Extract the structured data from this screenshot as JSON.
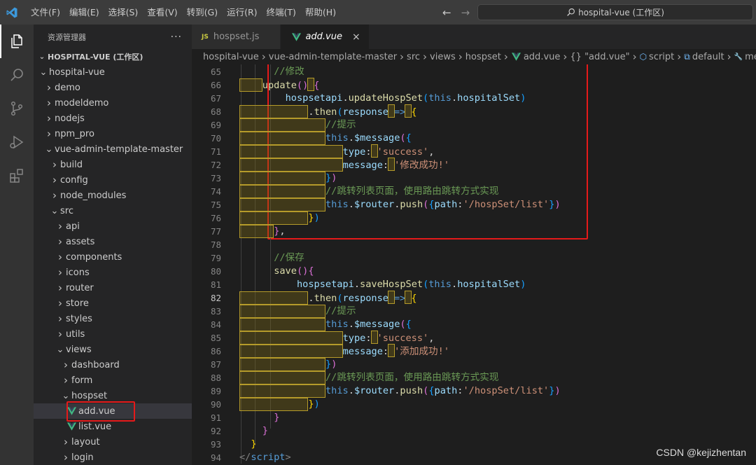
{
  "titlebar": {
    "menu": [
      "文件(F)",
      "编辑(E)",
      "选择(S)",
      "查看(V)",
      "转到(G)",
      "运行(R)",
      "终端(T)",
      "帮助(H)"
    ],
    "command_center": "hospital-vue (工作区)"
  },
  "sidebar": {
    "title": "资源管理器",
    "more": "···",
    "workspace": "HOSPITAL-VUE (工作区)",
    "tree": [
      {
        "label": "hospital-vue",
        "indent": 1,
        "chev": "down"
      },
      {
        "label": "demo",
        "indent": 2,
        "chev": "right"
      },
      {
        "label": "modeldemo",
        "indent": 2,
        "chev": "right"
      },
      {
        "label": "nodejs",
        "indent": 2,
        "chev": "right"
      },
      {
        "label": "npm_pro",
        "indent": 2,
        "chev": "right"
      },
      {
        "label": "vue-admin-template-master",
        "indent": 2,
        "chev": "down"
      },
      {
        "label": "build",
        "indent": 3,
        "chev": "right"
      },
      {
        "label": "config",
        "indent": 3,
        "chev": "right"
      },
      {
        "label": "node_modules",
        "indent": 3,
        "chev": "right"
      },
      {
        "label": "src",
        "indent": 3,
        "chev": "down"
      },
      {
        "label": "api",
        "indent": 4,
        "chev": "right"
      },
      {
        "label": "assets",
        "indent": 4,
        "chev": "right"
      },
      {
        "label": "components",
        "indent": 4,
        "chev": "right"
      },
      {
        "label": "icons",
        "indent": 4,
        "chev": "right"
      },
      {
        "label": "router",
        "indent": 4,
        "chev": "right"
      },
      {
        "label": "store",
        "indent": 4,
        "chev": "right"
      },
      {
        "label": "styles",
        "indent": 4,
        "chev": "right"
      },
      {
        "label": "utils",
        "indent": 4,
        "chev": "right"
      },
      {
        "label": "views",
        "indent": 4,
        "chev": "down"
      },
      {
        "label": "dashboard",
        "indent": 5,
        "chev": "right"
      },
      {
        "label": "form",
        "indent": 5,
        "chev": "right"
      },
      {
        "label": "hospset",
        "indent": 5,
        "chev": "down"
      },
      {
        "label": "add.vue",
        "indent": 6,
        "chev": "vue",
        "selected": true
      },
      {
        "label": "list.vue",
        "indent": 6,
        "chev": "vue"
      },
      {
        "label": "layout",
        "indent": 5,
        "chev": "right"
      },
      {
        "label": "login",
        "indent": 5,
        "chev": "right"
      }
    ]
  },
  "tabs": [
    {
      "label": "hospset.js",
      "badge": "JS",
      "active": false
    },
    {
      "label": "add.vue",
      "badge": "vue",
      "active": true,
      "close": "×"
    }
  ],
  "breadcrumb": [
    "hospital-vue",
    "vue-admin-template-master",
    "src",
    "views",
    "hospset",
    "add.vue",
    "{} \"add.vue\"",
    "script",
    "default",
    "methods"
  ],
  "editor": {
    "current_line": 82,
    "lines": [
      {
        "n": 65,
        "seg": [
          [
            6,
            "pad"
          ],
          [
            "//修改",
            "c"
          ]
        ]
      },
      {
        "n": 66,
        "seg": [
          [
            4,
            "padhl"
          ],
          [
            "update",
            "f"
          ],
          [
            "()",
            "b2"
          ],
          [
            "ws"
          ],
          [
            "{",
            "b2"
          ]
        ]
      },
      {
        "n": 67,
        "seg": [
          [
            8,
            "pad"
          ],
          [
            "hospsetapi",
            "v"
          ],
          [
            ".",
            "p"
          ],
          [
            "updateHospSet",
            "f"
          ],
          [
            "(",
            "b3"
          ],
          [
            "this",
            "k"
          ],
          [
            ".",
            "p"
          ],
          [
            "hospitalSet",
            "v"
          ],
          [
            ")",
            "b3"
          ]
        ]
      },
      {
        "n": 68,
        "seg": [
          [
            12,
            "padhl"
          ],
          [
            ".",
            "p"
          ],
          [
            "then",
            "f"
          ],
          [
            "(",
            "b3"
          ],
          [
            "response",
            "v"
          ],
          [
            "ws"
          ],
          [
            "=>",
            "k"
          ],
          [
            "ws"
          ],
          [
            "{",
            "b1"
          ]
        ]
      },
      {
        "n": 69,
        "seg": [
          [
            15,
            "padhl"
          ],
          [
            "//提示",
            "c"
          ]
        ]
      },
      {
        "n": 70,
        "seg": [
          [
            15,
            "padhl"
          ],
          [
            "this",
            "k"
          ],
          [
            ".",
            "p"
          ],
          [
            "$message",
            "v"
          ],
          [
            "(",
            "b2"
          ],
          [
            "{",
            "b3"
          ]
        ]
      },
      {
        "n": 71,
        "seg": [
          [
            18,
            "padhl"
          ],
          [
            "type",
            "v"
          ],
          [
            ":",
            "p"
          ],
          [
            "ws"
          ],
          [
            "'success'",
            "s"
          ],
          [
            ",",
            "p"
          ]
        ]
      },
      {
        "n": 72,
        "seg": [
          [
            18,
            "padhl"
          ],
          [
            "message",
            "v"
          ],
          [
            ":",
            "p"
          ],
          [
            "ws"
          ],
          [
            "'修改成功!'",
            "s"
          ]
        ]
      },
      {
        "n": 73,
        "seg": [
          [
            15,
            "padhl"
          ],
          [
            "}",
            "b3"
          ],
          [
            ")",
            "b2"
          ]
        ]
      },
      {
        "n": 74,
        "seg": [
          [
            15,
            "padhl"
          ],
          [
            "//跳转列表页面，使用路由跳转方式实现",
            "c"
          ]
        ]
      },
      {
        "n": 75,
        "seg": [
          [
            15,
            "padhl"
          ],
          [
            "this",
            "k"
          ],
          [
            ".",
            "p"
          ],
          [
            "$router",
            "v"
          ],
          [
            ".",
            "p"
          ],
          [
            "push",
            "f"
          ],
          [
            "(",
            "b2"
          ],
          [
            "{",
            "b3"
          ],
          [
            "path",
            "v"
          ],
          [
            ":",
            "p"
          ],
          [
            "'/hospSet/list'",
            "s"
          ],
          [
            "}",
            "b3"
          ],
          [
            ")",
            "b2"
          ]
        ]
      },
      {
        "n": 76,
        "seg": [
          [
            12,
            "padhl"
          ],
          [
            "}",
            "b1"
          ],
          [
            ")",
            "b3"
          ]
        ]
      },
      {
        "n": 77,
        "seg": [
          [
            6,
            "padhl"
          ],
          [
            "}",
            "b2"
          ],
          [
            ",",
            "p"
          ]
        ]
      },
      {
        "n": 78,
        "seg": []
      },
      {
        "n": 79,
        "seg": [
          [
            6,
            "pad"
          ],
          [
            "//保存",
            "c"
          ]
        ]
      },
      {
        "n": 80,
        "seg": [
          [
            6,
            "pad"
          ],
          [
            "save",
            "f"
          ],
          [
            "()",
            "b2"
          ],
          [
            "{",
            "b2"
          ]
        ]
      },
      {
        "n": 81,
        "seg": [
          [
            10,
            "pad"
          ],
          [
            "hospsetapi",
            "v"
          ],
          [
            ".",
            "p"
          ],
          [
            "saveHospSet",
            "f"
          ],
          [
            "(",
            "b3"
          ],
          [
            "this",
            "k"
          ],
          [
            ".",
            "p"
          ],
          [
            "hospitalSet",
            "v"
          ],
          [
            ")",
            "b3"
          ]
        ]
      },
      {
        "n": 82,
        "seg": [
          [
            12,
            "padhl"
          ],
          [
            ".",
            "p"
          ],
          [
            "then",
            "f"
          ],
          [
            "(",
            "b3"
          ],
          [
            "response",
            "v"
          ],
          [
            "ws"
          ],
          [
            "=>",
            "k"
          ],
          [
            "ws"
          ],
          [
            "{",
            "b1"
          ]
        ]
      },
      {
        "n": 83,
        "seg": [
          [
            15,
            "padhl"
          ],
          [
            "//提示",
            "c"
          ]
        ]
      },
      {
        "n": 84,
        "seg": [
          [
            15,
            "padhl"
          ],
          [
            "this",
            "k"
          ],
          [
            ".",
            "p"
          ],
          [
            "$message",
            "v"
          ],
          [
            "(",
            "b2"
          ],
          [
            "{",
            "b3"
          ]
        ]
      },
      {
        "n": 85,
        "seg": [
          [
            18,
            "padhl"
          ],
          [
            "type",
            "v"
          ],
          [
            ":",
            "p"
          ],
          [
            "ws"
          ],
          [
            "'success'",
            "s"
          ],
          [
            ",",
            "p"
          ]
        ]
      },
      {
        "n": 86,
        "seg": [
          [
            18,
            "padhl"
          ],
          [
            "message",
            "v"
          ],
          [
            ":",
            "p"
          ],
          [
            "ws"
          ],
          [
            "'添加成功!'",
            "s"
          ]
        ]
      },
      {
        "n": 87,
        "seg": [
          [
            15,
            "padhl"
          ],
          [
            "}",
            "b3"
          ],
          [
            ")",
            "b2"
          ]
        ]
      },
      {
        "n": 88,
        "seg": [
          [
            15,
            "padhl"
          ],
          [
            "//跳转列表页面，使用路由跳转方式实现",
            "c"
          ]
        ]
      },
      {
        "n": 89,
        "seg": [
          [
            15,
            "padhl"
          ],
          [
            "this",
            "k"
          ],
          [
            ".",
            "p"
          ],
          [
            "$router",
            "v"
          ],
          [
            ".",
            "p"
          ],
          [
            "push",
            "f"
          ],
          [
            "(",
            "b2"
          ],
          [
            "{",
            "b3"
          ],
          [
            "path",
            "v"
          ],
          [
            ":",
            "p"
          ],
          [
            "'/hospSet/list'",
            "s"
          ],
          [
            "}",
            "b3"
          ],
          [
            ")",
            "b2"
          ]
        ]
      },
      {
        "n": 90,
        "seg": [
          [
            12,
            "padhl"
          ],
          [
            "}",
            "b1"
          ],
          [
            ")",
            "b3"
          ]
        ]
      },
      {
        "n": 91,
        "seg": [
          [
            6,
            "pad"
          ],
          [
            "}",
            "b2"
          ]
        ]
      },
      {
        "n": 92,
        "seg": [
          [
            4,
            "pad"
          ],
          [
            "}",
            "b2"
          ]
        ]
      },
      {
        "n": 93,
        "seg": [
          [
            2,
            "pad"
          ],
          [
            "}",
            "b1"
          ]
        ]
      },
      {
        "n": 94,
        "seg": [
          [
            "</",
            "g"
          ],
          [
            "script",
            "k"
          ],
          [
            ">",
            "g"
          ]
        ]
      }
    ]
  },
  "watermark": "CSDN @kejizhentan",
  "colors": {
    "accent": "#007acc",
    "highlight_box": "#e51a1a"
  }
}
